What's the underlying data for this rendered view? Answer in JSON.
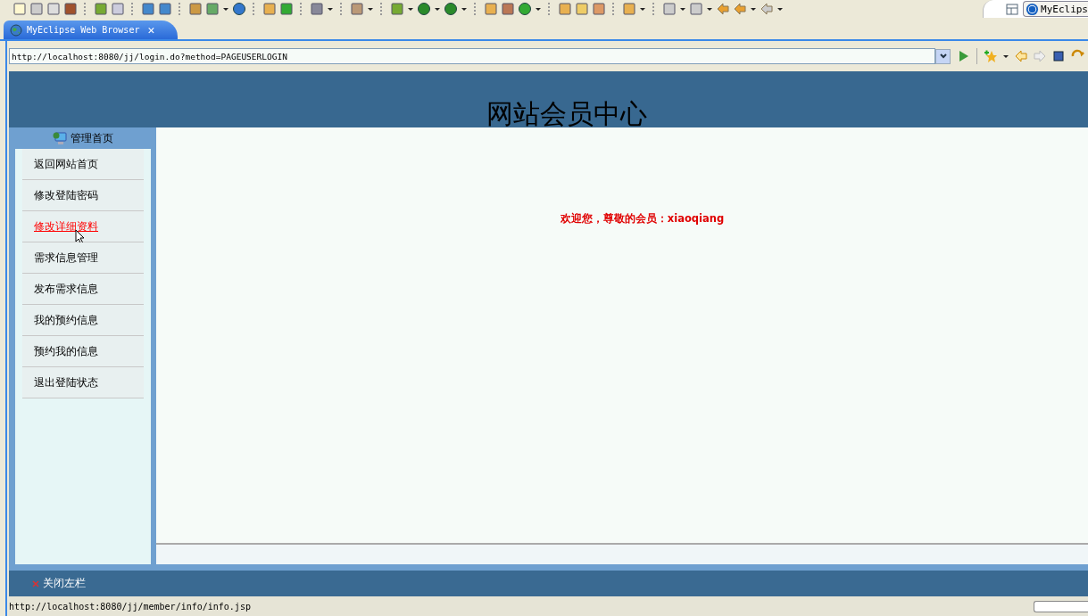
{
  "perspective": {
    "label": "MyEclips"
  },
  "editor_tab": {
    "title": "MyEclipse Web Browser",
    "close": "✕",
    "selected": true
  },
  "address_bar": {
    "value": "http://localhost:8080/jj/login.do?method=PAGEUSERLOGIN"
  },
  "page": {
    "title": "网站会员中心",
    "sidebar": {
      "heading": "管理首页",
      "items": [
        {
          "label": "返回网站首页",
          "hovered": false
        },
        {
          "label": "修改登陆密码",
          "hovered": false
        },
        {
          "label": "修改详细资料",
          "hovered": true
        },
        {
          "label": "需求信息管理",
          "hovered": false
        },
        {
          "label": "发布需求信息",
          "hovered": false
        },
        {
          "label": "我的预约信息",
          "hovered": false
        },
        {
          "label": "预约我的信息",
          "hovered": false
        },
        {
          "label": "退出登陆状态",
          "hovered": false
        }
      ]
    },
    "welcome": "欢迎您，尊敬的会员：xiaoqiang",
    "footer": {
      "close_sidebar": "关闭左栏"
    }
  },
  "status_bar": {
    "text": "http://localhost:8080/jj/member/info/info.jsp",
    "progress": {
      "level": 0
    }
  }
}
